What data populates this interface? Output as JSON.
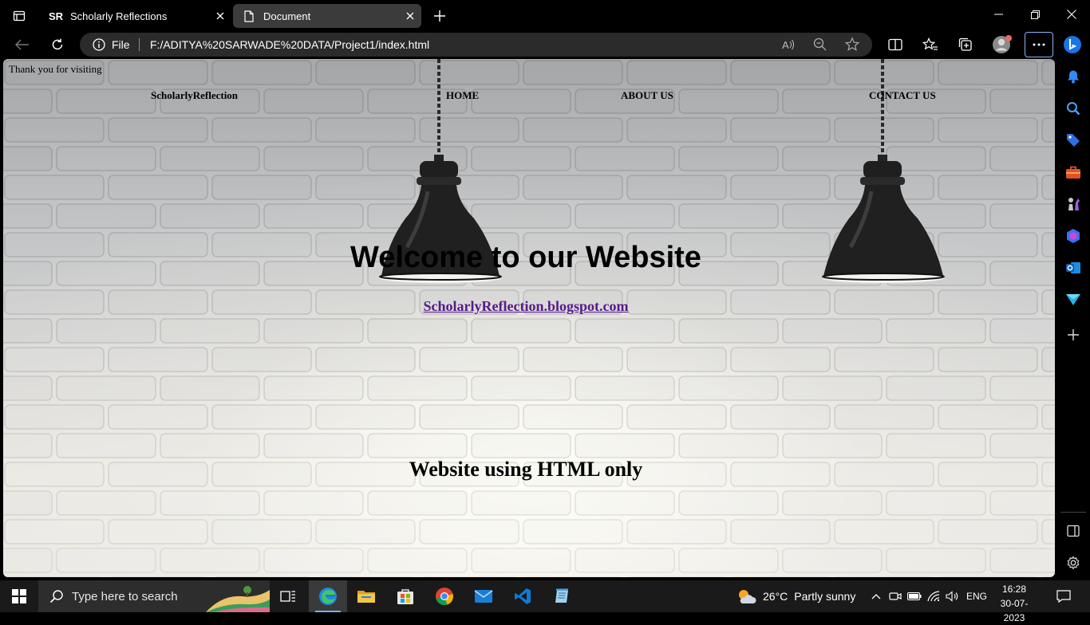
{
  "browser": {
    "tabs": [
      {
        "favicon_text": "SR",
        "title": "Scholarly Reflections",
        "active": false
      },
      {
        "title": "Document",
        "active": true
      }
    ],
    "address": {
      "scheme_label": "File",
      "url": "F:/ADITYA%20SARWADE%20DATA/Project1/index.html"
    }
  },
  "page": {
    "thanks": "Thank you for visiting",
    "nav": {
      "brand": "ScholarlyReflection",
      "home": "HOME",
      "about": "ABOUT US",
      "contact": "CONTACT US"
    },
    "heading": "Welcome to our Website",
    "link_text": "ScholarlyReflection.blogspot.com",
    "subheading": "Website using HTML only",
    "link_color": "#551a8b"
  },
  "sidebar": {
    "icons": [
      "bell-icon",
      "search-icon",
      "tag-icon",
      "briefcase-icon",
      "chess-icon",
      "office-icon",
      "outlook-icon",
      "send-icon",
      "add-icon",
      "split-screen-icon",
      "settings-icon"
    ]
  },
  "taskbar": {
    "search_placeholder": "Type here to search",
    "weather": {
      "temp": "26°C",
      "condition": "Partly sunny"
    },
    "language": "ENG",
    "time": "16:28",
    "date": "30-07-2023"
  }
}
